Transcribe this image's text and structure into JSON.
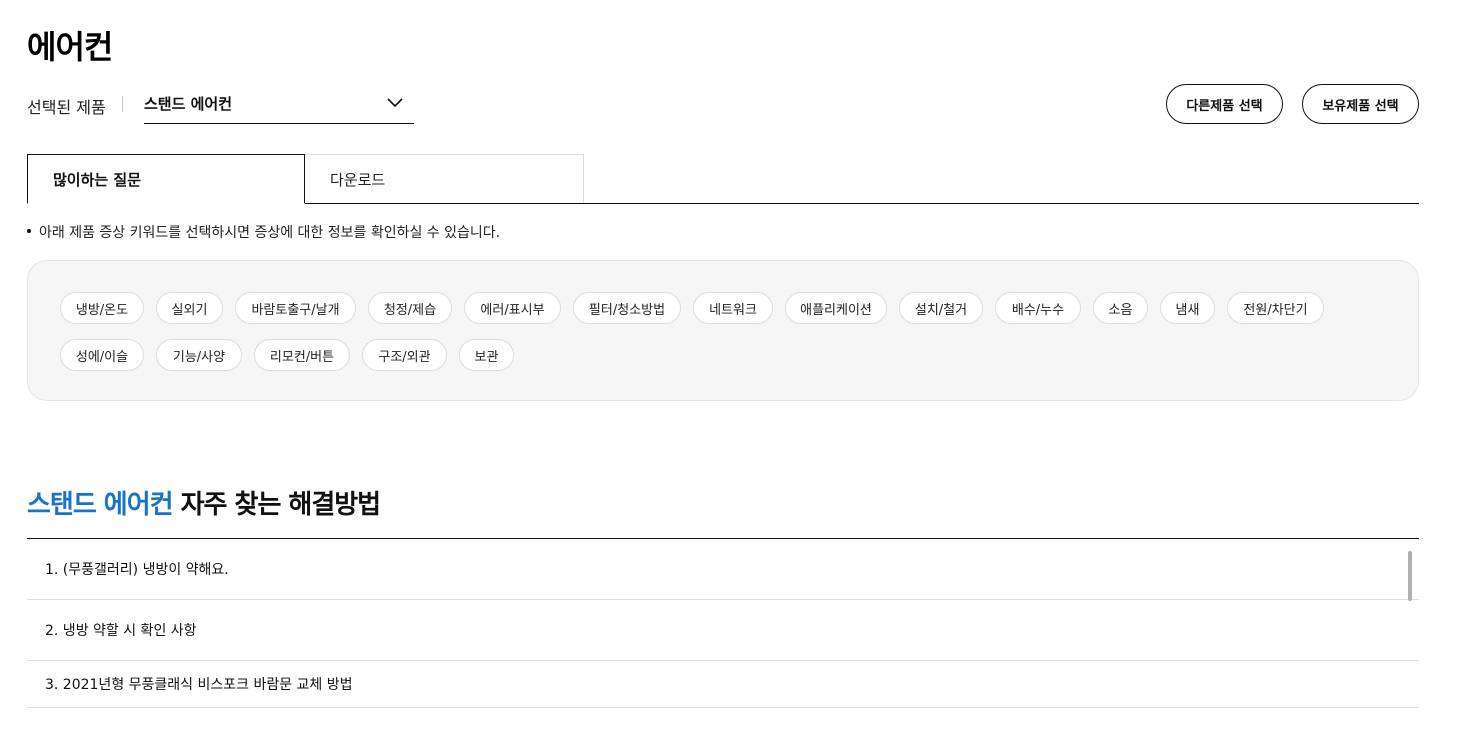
{
  "page": {
    "title": "에어컨"
  },
  "selector": {
    "label": "선택된 제품",
    "value": "스탠드 에어컨",
    "other_button": "다른제품 선택",
    "owned_button": "보유제품 선택"
  },
  "tabs": [
    {
      "label": "많이하는 질문",
      "active": true
    },
    {
      "label": "다운로드",
      "active": false
    }
  ],
  "notice": "아래 제품 증상 키워드를 선택하시면 증상에 대한 정보를 확인하실 수 있습니다.",
  "keywords": {
    "row1": [
      "냉방/온도",
      "실외기",
      "바람토출구/날개",
      "청정/제습",
      "에러/표시부",
      "필터/청소방법",
      "네트워크",
      "애플리케이션",
      "설치/철거",
      "배수/누수",
      "소음",
      "냄새",
      "전원/차단기"
    ],
    "row2": [
      "성에/이슬",
      "기능/사양",
      "리모컨/버튼",
      "구조/외관",
      "보관"
    ]
  },
  "section": {
    "product": "스탠드 에어컨",
    "rest": "자주 찾는 해결방법"
  },
  "faq": [
    "1. (무풍갤러리) 냉방이 약해요.",
    "2. 냉방 약할 시 확인 사항",
    "3. 2021년형 무풍클래식 비스포크 바람문 교체 방법"
  ]
}
